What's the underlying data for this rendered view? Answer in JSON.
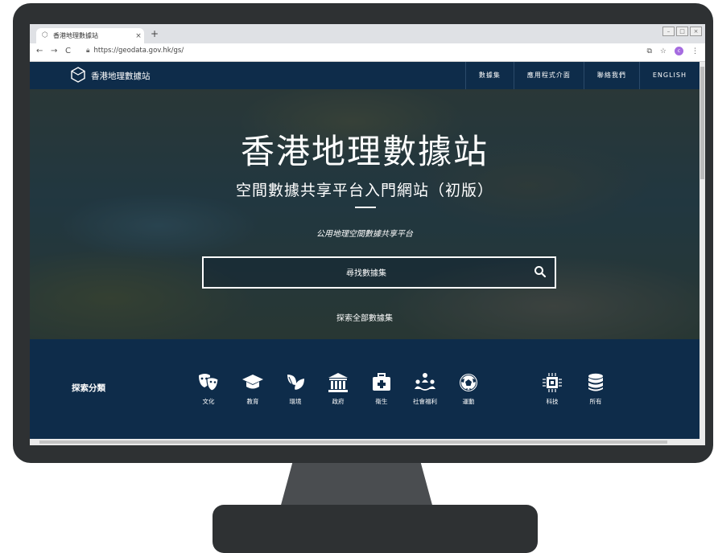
{
  "browser": {
    "tab_title": "香港地理數據站",
    "tab_close": "×",
    "new_tab": "+",
    "url": "https://geodata.gov.hk/gs/",
    "avatar_initial": "c"
  },
  "navbar": {
    "logo_text": "香港地理數據站",
    "links": [
      "數據集",
      "應用程式介面",
      "聯絡我們",
      "ENGLISH"
    ]
  },
  "hero": {
    "title": "香港地理數據站",
    "subtitle": "空間數據共享平台入門網站（初版）",
    "tagline": "公用地理空間數據共享平台",
    "search_placeholder": "尋找數據集",
    "explore_all": "探索全部數據集"
  },
  "categories": {
    "title": "探索分類",
    "items": [
      {
        "label": "文化",
        "icon": "theater-masks-icon"
      },
      {
        "label": "教育",
        "icon": "graduation-cap-icon"
      },
      {
        "label": "環境",
        "icon": "leaves-icon"
      },
      {
        "label": "政府",
        "icon": "government-building-icon"
      },
      {
        "label": "衛生",
        "icon": "medical-kit-icon"
      },
      {
        "label": "社會福利",
        "icon": "community-people-icon"
      },
      {
        "label": "運動",
        "icon": "soccer-ball-icon"
      },
      {
        "label": "科技",
        "icon": "microchip-icon"
      },
      {
        "label": "所有",
        "icon": "database-icon"
      }
    ]
  },
  "colors": {
    "nav_bg": "#0e2c4a",
    "bezel": "#2e3133"
  }
}
